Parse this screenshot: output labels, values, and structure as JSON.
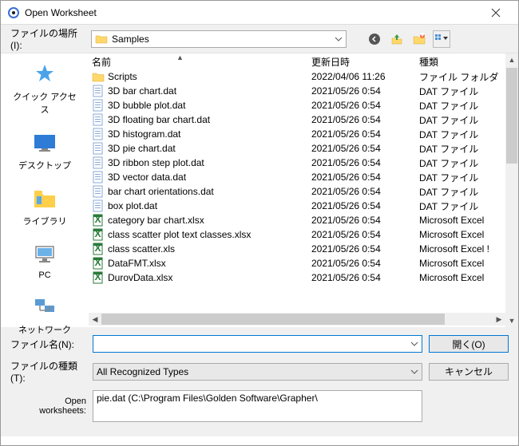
{
  "title": "Open Worksheet",
  "loc_label": "ファイルの場所(I):",
  "folder": "Samples",
  "places": [
    {
      "label": "クイック アクセス"
    },
    {
      "label": "デスクトップ"
    },
    {
      "label": "ライブラリ"
    },
    {
      "label": "PC"
    },
    {
      "label": "ネットワーク"
    }
  ],
  "cols": {
    "c1": "名前",
    "c2": "更新日時",
    "c3": "種類"
  },
  "rows": [
    {
      "name": "Scripts",
      "date": "2022/04/06 11:26",
      "type": "ファイル フォルダー",
      "icon": "folder"
    },
    {
      "name": "3D bar chart.dat",
      "date": "2021/05/26 0:54",
      "type": "DAT ファイル",
      "icon": "dat"
    },
    {
      "name": "3D bubble plot.dat",
      "date": "2021/05/26 0:54",
      "type": "DAT ファイル",
      "icon": "dat"
    },
    {
      "name": "3D floating bar chart.dat",
      "date": "2021/05/26 0:54",
      "type": "DAT ファイル",
      "icon": "dat"
    },
    {
      "name": "3D histogram.dat",
      "date": "2021/05/26 0:54",
      "type": "DAT ファイル",
      "icon": "dat"
    },
    {
      "name": "3D pie chart.dat",
      "date": "2021/05/26 0:54",
      "type": "DAT ファイル",
      "icon": "dat"
    },
    {
      "name": "3D ribbon step plot.dat",
      "date": "2021/05/26 0:54",
      "type": "DAT ファイル",
      "icon": "dat"
    },
    {
      "name": "3D vector data.dat",
      "date": "2021/05/26 0:54",
      "type": "DAT ファイル",
      "icon": "dat"
    },
    {
      "name": "bar chart orientations.dat",
      "date": "2021/05/26 0:54",
      "type": "DAT ファイル",
      "icon": "dat"
    },
    {
      "name": "box plot.dat",
      "date": "2021/05/26 0:54",
      "type": "DAT ファイル",
      "icon": "dat"
    },
    {
      "name": "category bar chart.xlsx",
      "date": "2021/05/26 0:54",
      "type": "Microsoft Excel ",
      "icon": "xls"
    },
    {
      "name": "class scatter plot text classes.xlsx",
      "date": "2021/05/26 0:54",
      "type": "Microsoft Excel ",
      "icon": "xls"
    },
    {
      "name": "class scatter.xls",
      "date": "2021/05/26 0:54",
      "type": "Microsoft Excel !",
      "icon": "xls"
    },
    {
      "name": "DataFMT.xlsx",
      "date": "2021/05/26 0:54",
      "type": "Microsoft Excel ",
      "icon": "xls"
    },
    {
      "name": "DurovData.xlsx",
      "date": "2021/05/26 0:54",
      "type": "Microsoft Excel ",
      "icon": "xls"
    }
  ],
  "file_label": "ファイル名(N):",
  "file_value": "",
  "type_label": "ファイルの種類(T):",
  "type_value": "All Recognized Types",
  "open_btn": "開く(O)",
  "cancel_btn": "キャンセル",
  "ows_label": "Open\nworksheets:",
  "ows_value": "pie.dat (C:\\Program Files\\Golden Software\\Grapher\\"
}
